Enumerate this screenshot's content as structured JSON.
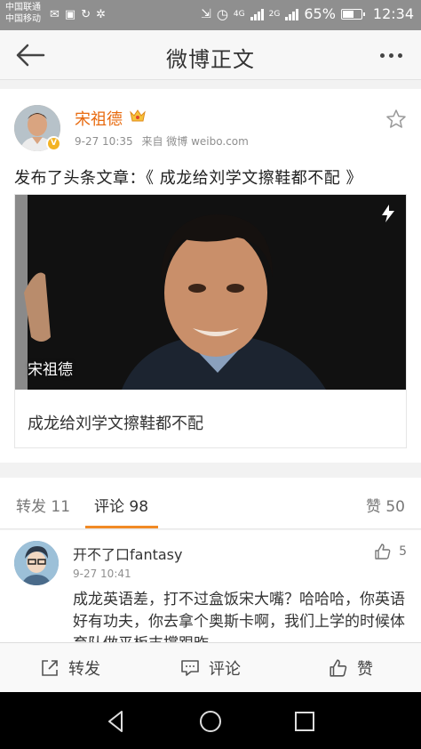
{
  "status_bar": {
    "carrier_1": "中国联通",
    "carrier_2": "中国移动",
    "network": "4G",
    "network_2": "2G",
    "battery_percent": "65%",
    "battery_level": 0.65,
    "time": "12:34"
  },
  "nav": {
    "title": "微博正文"
  },
  "post": {
    "author": "宋祖德",
    "time": "9-27 10:35",
    "source": "来自 微博 weibo.com",
    "text": "发布了头条文章：《 成龙给刘学文擦鞋都不配 》",
    "article": {
      "image_caption": "宋祖德",
      "title": "成龙给刘学文擦鞋都不配"
    }
  },
  "tabs": {
    "repost": "转发 11",
    "comment": "评论 98",
    "like": "赞 50"
  },
  "comment": {
    "user": "开不了口fantasy",
    "time": "9-27 10:41",
    "likes": "5",
    "text": "成龙英语差，打不过盒饭宋大嘴？哈哈哈，你英语好有功夫，你去拿个奥斯卡啊，我们上学的时候体育队做平板支撑跟昨"
  },
  "actions": {
    "repost": "转发",
    "comment": "评论",
    "like": "赞"
  },
  "colors": {
    "accent": "#f18a25",
    "author": "#e86b10",
    "verified": "#f3b323"
  }
}
